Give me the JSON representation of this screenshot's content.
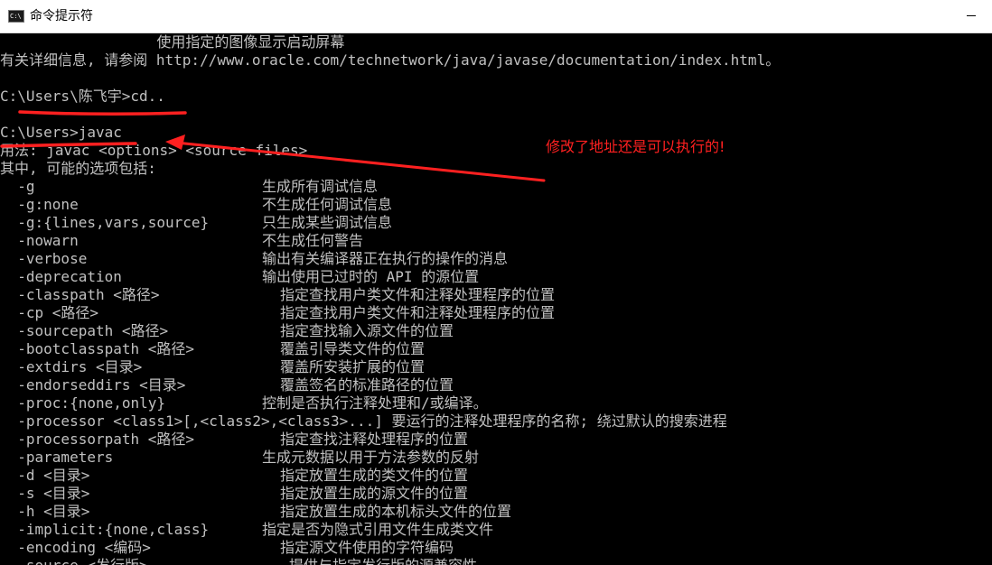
{
  "window": {
    "title": "命令提示符",
    "icon": "cmd-icon"
  },
  "console": {
    "lines": [
      "                  使用指定的图像显示启动屏幕",
      "有关详细信息, 请参阅 http://www.oracle.com/technetwork/java/javase/documentation/index.html。",
      "",
      "C:\\Users\\陈飞宇>cd..",
      "",
      "C:\\Users>javac",
      "用法: javac <options> <source files>",
      "其中, 可能的选项包括:"
    ],
    "options": [
      {
        "opt": "  -g",
        "desc": "生成所有调试信息",
        "indent": 0
      },
      {
        "opt": "  -g:none",
        "desc": "不生成任何调试信息",
        "indent": 0
      },
      {
        "opt": "  -g:{lines,vars,source}",
        "desc": "只生成某些调试信息",
        "indent": 0
      },
      {
        "opt": "  -nowarn",
        "desc": "不生成任何警告",
        "indent": 0
      },
      {
        "opt": "  -verbose",
        "desc": "输出有关编译器正在执行的操作的消息",
        "indent": 0
      },
      {
        "opt": "  -deprecation",
        "desc": "输出使用已过时的 API 的源位置",
        "indent": 0
      },
      {
        "opt": "  -classpath <路径>",
        "desc": "指定查找用户类文件和注释处理程序的位置",
        "indent": 1
      },
      {
        "opt": "  -cp <路径>",
        "desc": "指定查找用户类文件和注释处理程序的位置",
        "indent": 1
      },
      {
        "opt": "  -sourcepath <路径>",
        "desc": "指定查找输入源文件的位置",
        "indent": 1
      },
      {
        "opt": "  -bootclasspath <路径>",
        "desc": "覆盖引导类文件的位置",
        "indent": 1
      },
      {
        "opt": "  -extdirs <目录>",
        "desc": "覆盖所安装扩展的位置",
        "indent": 1
      },
      {
        "opt": "  -endorseddirs <目录>",
        "desc": "覆盖签名的标准路径的位置",
        "indent": 1
      },
      {
        "opt": "  -proc:{none,only}",
        "desc": "控制是否执行注释处理和/或编译。",
        "indent": 0
      },
      {
        "opt": "  -processor <class1>[,<class2>,<class3>...] 要运行的注释处理程序的名称; 绕过默认的搜索进程",
        "desc": "",
        "indent": 0
      },
      {
        "opt": "  -processorpath <路径>",
        "desc": "指定查找注释处理程序的位置",
        "indent": 1
      },
      {
        "opt": "  -parameters",
        "desc": "生成元数据以用于方法参数的反射",
        "indent": 0
      },
      {
        "opt": "  -d <目录>",
        "desc": "指定放置生成的类文件的位置",
        "indent": 1
      },
      {
        "opt": "  -s <目录>",
        "desc": "指定放置生成的源文件的位置",
        "indent": 1
      },
      {
        "opt": "  -h <目录>",
        "desc": "指定放置生成的本机标头文件的位置",
        "indent": 1
      },
      {
        "opt": "  -implicit:{none,class}",
        "desc": "指定是否为隐式引用文件生成类文件",
        "indent": 0
      },
      {
        "opt": "  -encoding <编码>",
        "desc": "指定源文件使用的字符编码",
        "indent": 1
      },
      {
        "opt": "  -source <发行版>",
        "desc": "提供与指定发行版的源兼容性",
        "indent": 2
      }
    ]
  },
  "annotation": {
    "text": "修改了地址还是可以执行的!",
    "color": "#ff2020"
  },
  "colors": {
    "console_bg": "#000000",
    "console_fg": "#c0c0c0"
  }
}
